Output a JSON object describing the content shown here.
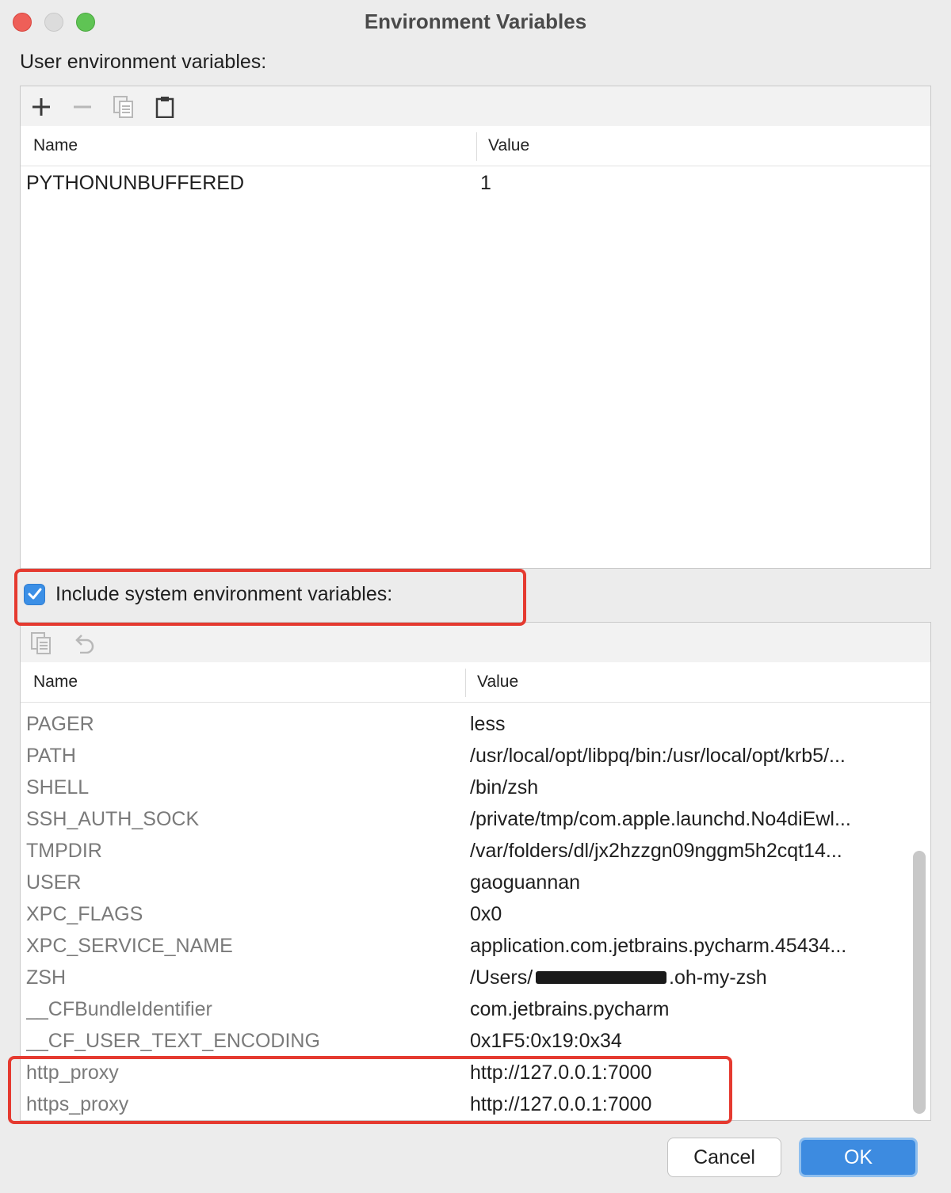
{
  "window": {
    "title": "Environment Variables"
  },
  "user_section": {
    "label": "User environment variables:",
    "toolbar": {
      "icons": [
        "plus-icon",
        "minus-icon",
        "copy-icon",
        "paste-icon"
      ]
    },
    "columns": {
      "name": "Name",
      "value": "Value"
    },
    "rows": [
      {
        "name": "PYTHONUNBUFFERED",
        "value": "1"
      }
    ]
  },
  "include_system": {
    "checked": true,
    "label": "Include system environment variables:"
  },
  "system_section": {
    "toolbar": {
      "icons": [
        "copy-icon",
        "undo-icon"
      ]
    },
    "columns": {
      "name": "Name",
      "value": "Value"
    },
    "rows": [
      {
        "name": "PAGER",
        "value": "less"
      },
      {
        "name": "PATH",
        "value": "/usr/local/opt/libpq/bin:/usr/local/opt/krb5/..."
      },
      {
        "name": "SHELL",
        "value": "/bin/zsh"
      },
      {
        "name": "SSH_AUTH_SOCK",
        "value": "/private/tmp/com.apple.launchd.No4diEwl..."
      },
      {
        "name": "TMPDIR",
        "value": "/var/folders/dl/jx2hzzgn09nggm5h2cqt14..."
      },
      {
        "name": "USER",
        "value": "gaoguannan"
      },
      {
        "name": "XPC_FLAGS",
        "value": "0x0"
      },
      {
        "name": "XPC_SERVICE_NAME",
        "value": "application.com.jetbrains.pycharm.45434..."
      },
      {
        "name": "ZSH",
        "value": "/Users/",
        "value_suffix": ".oh-my-zsh"
      },
      {
        "name": "__CFBundleIdentifier",
        "value": "com.jetbrains.pycharm"
      },
      {
        "name": "__CF_USER_TEXT_ENCODING",
        "value": "0x1F5:0x19:0x34"
      },
      {
        "name": "http_proxy",
        "value": "http://127.0.0.1:7000"
      },
      {
        "name": "https_proxy",
        "value": "http://127.0.0.1:7000"
      }
    ]
  },
  "buttons": {
    "cancel": "Cancel",
    "ok": "OK"
  },
  "colors": {
    "highlight": "#e53a30",
    "accent": "#3d8be0"
  }
}
